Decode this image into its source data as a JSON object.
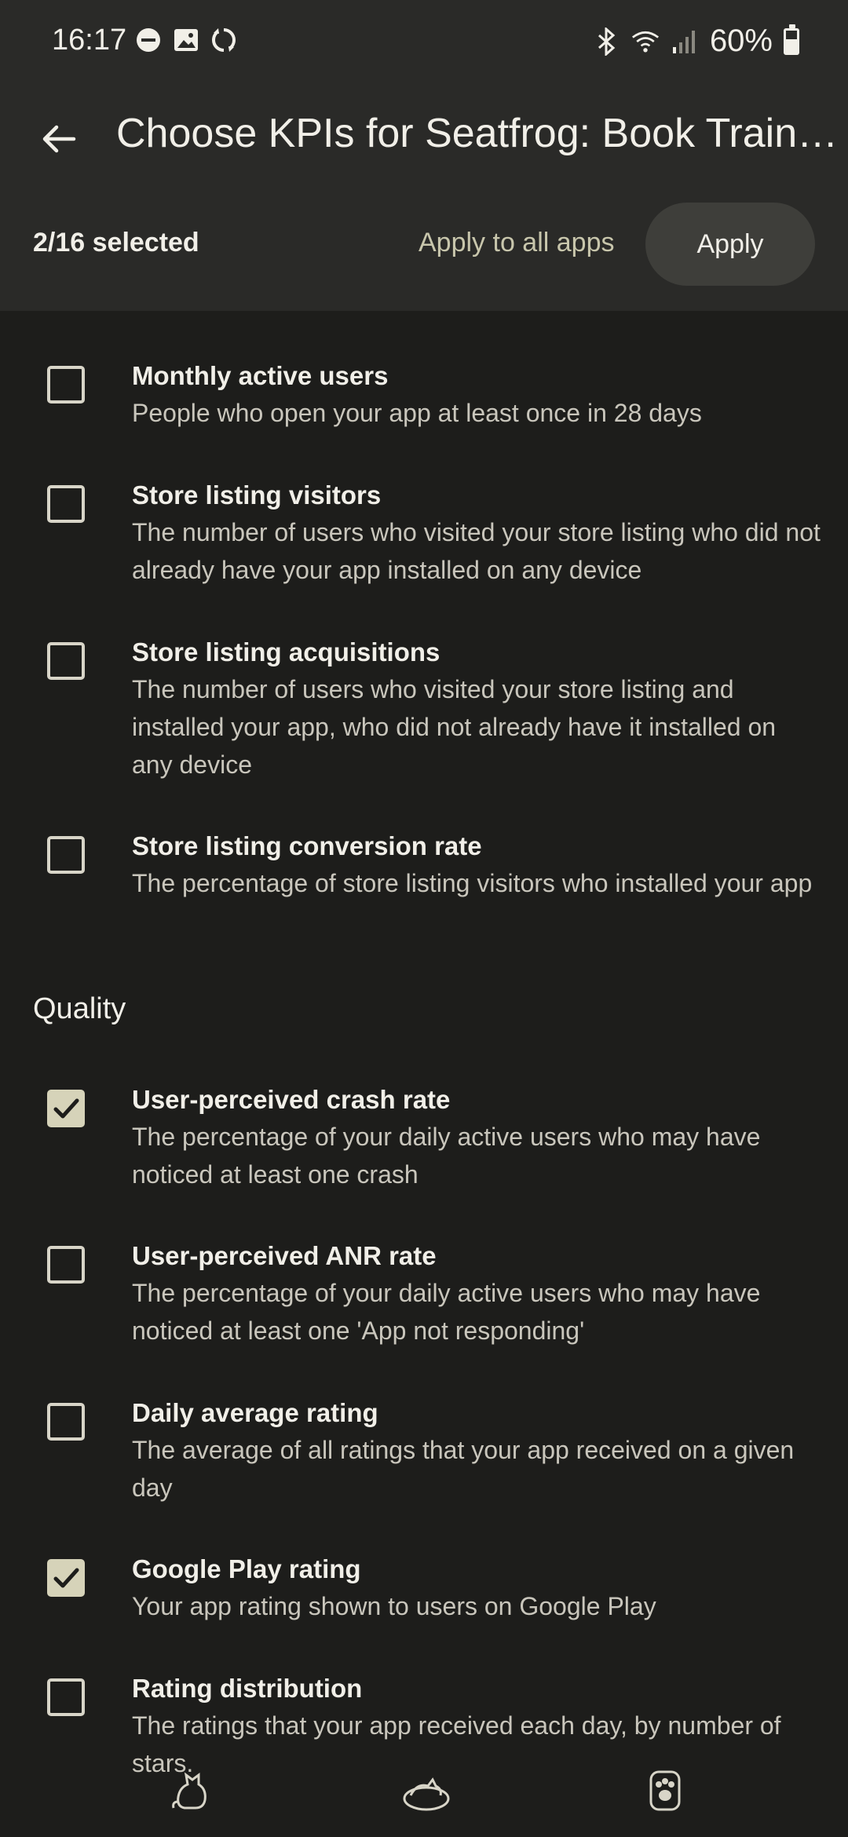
{
  "status_bar": {
    "time": "16:17",
    "battery": "60%"
  },
  "app_bar": {
    "title": "Choose KPIs for Seatfrog: Book Train T..."
  },
  "selection": {
    "count": "2/16 selected",
    "apply_all_label": "Apply to all apps",
    "apply_label": "Apply"
  },
  "items": [
    {
      "title": "Monthly active users",
      "desc": "People who open your app at least once in 28 days",
      "checked": false
    },
    {
      "title": "Store listing visitors",
      "desc": "The number of users who visited your store listing who did not already have your app installed on any device",
      "checked": false
    },
    {
      "title": "Store listing acquisitions",
      "desc": "The number of users who visited your store listing and installed your app, who did not already have it installed on any device",
      "checked": false
    },
    {
      "title": "Store listing conversion rate",
      "desc": "The percentage of store listing visitors who installed your app",
      "checked": false
    }
  ],
  "quality_section": {
    "title": "Quality",
    "items": [
      {
        "title": "User-perceived crash rate",
        "desc": "The percentage of your daily active users who may have noticed at least one crash",
        "checked": true
      },
      {
        "title": "User-perceived ANR rate",
        "desc": "The percentage of your daily active users who may have noticed at least one 'App not responding'",
        "checked": false
      },
      {
        "title": "Daily average rating",
        "desc": "The average of all ratings that your app received on a given day",
        "checked": false
      },
      {
        "title": "Google Play rating",
        "desc": "Your app rating shown to users on Google Play",
        "checked": true
      },
      {
        "title": "Rating distribution",
        "desc": "The ratings that your app received each day, by number of stars.",
        "checked": false
      }
    ]
  },
  "colors": {
    "background": "#1d1d1b",
    "topbar": "#2a2a28",
    "accent": "#d6d3b9"
  }
}
